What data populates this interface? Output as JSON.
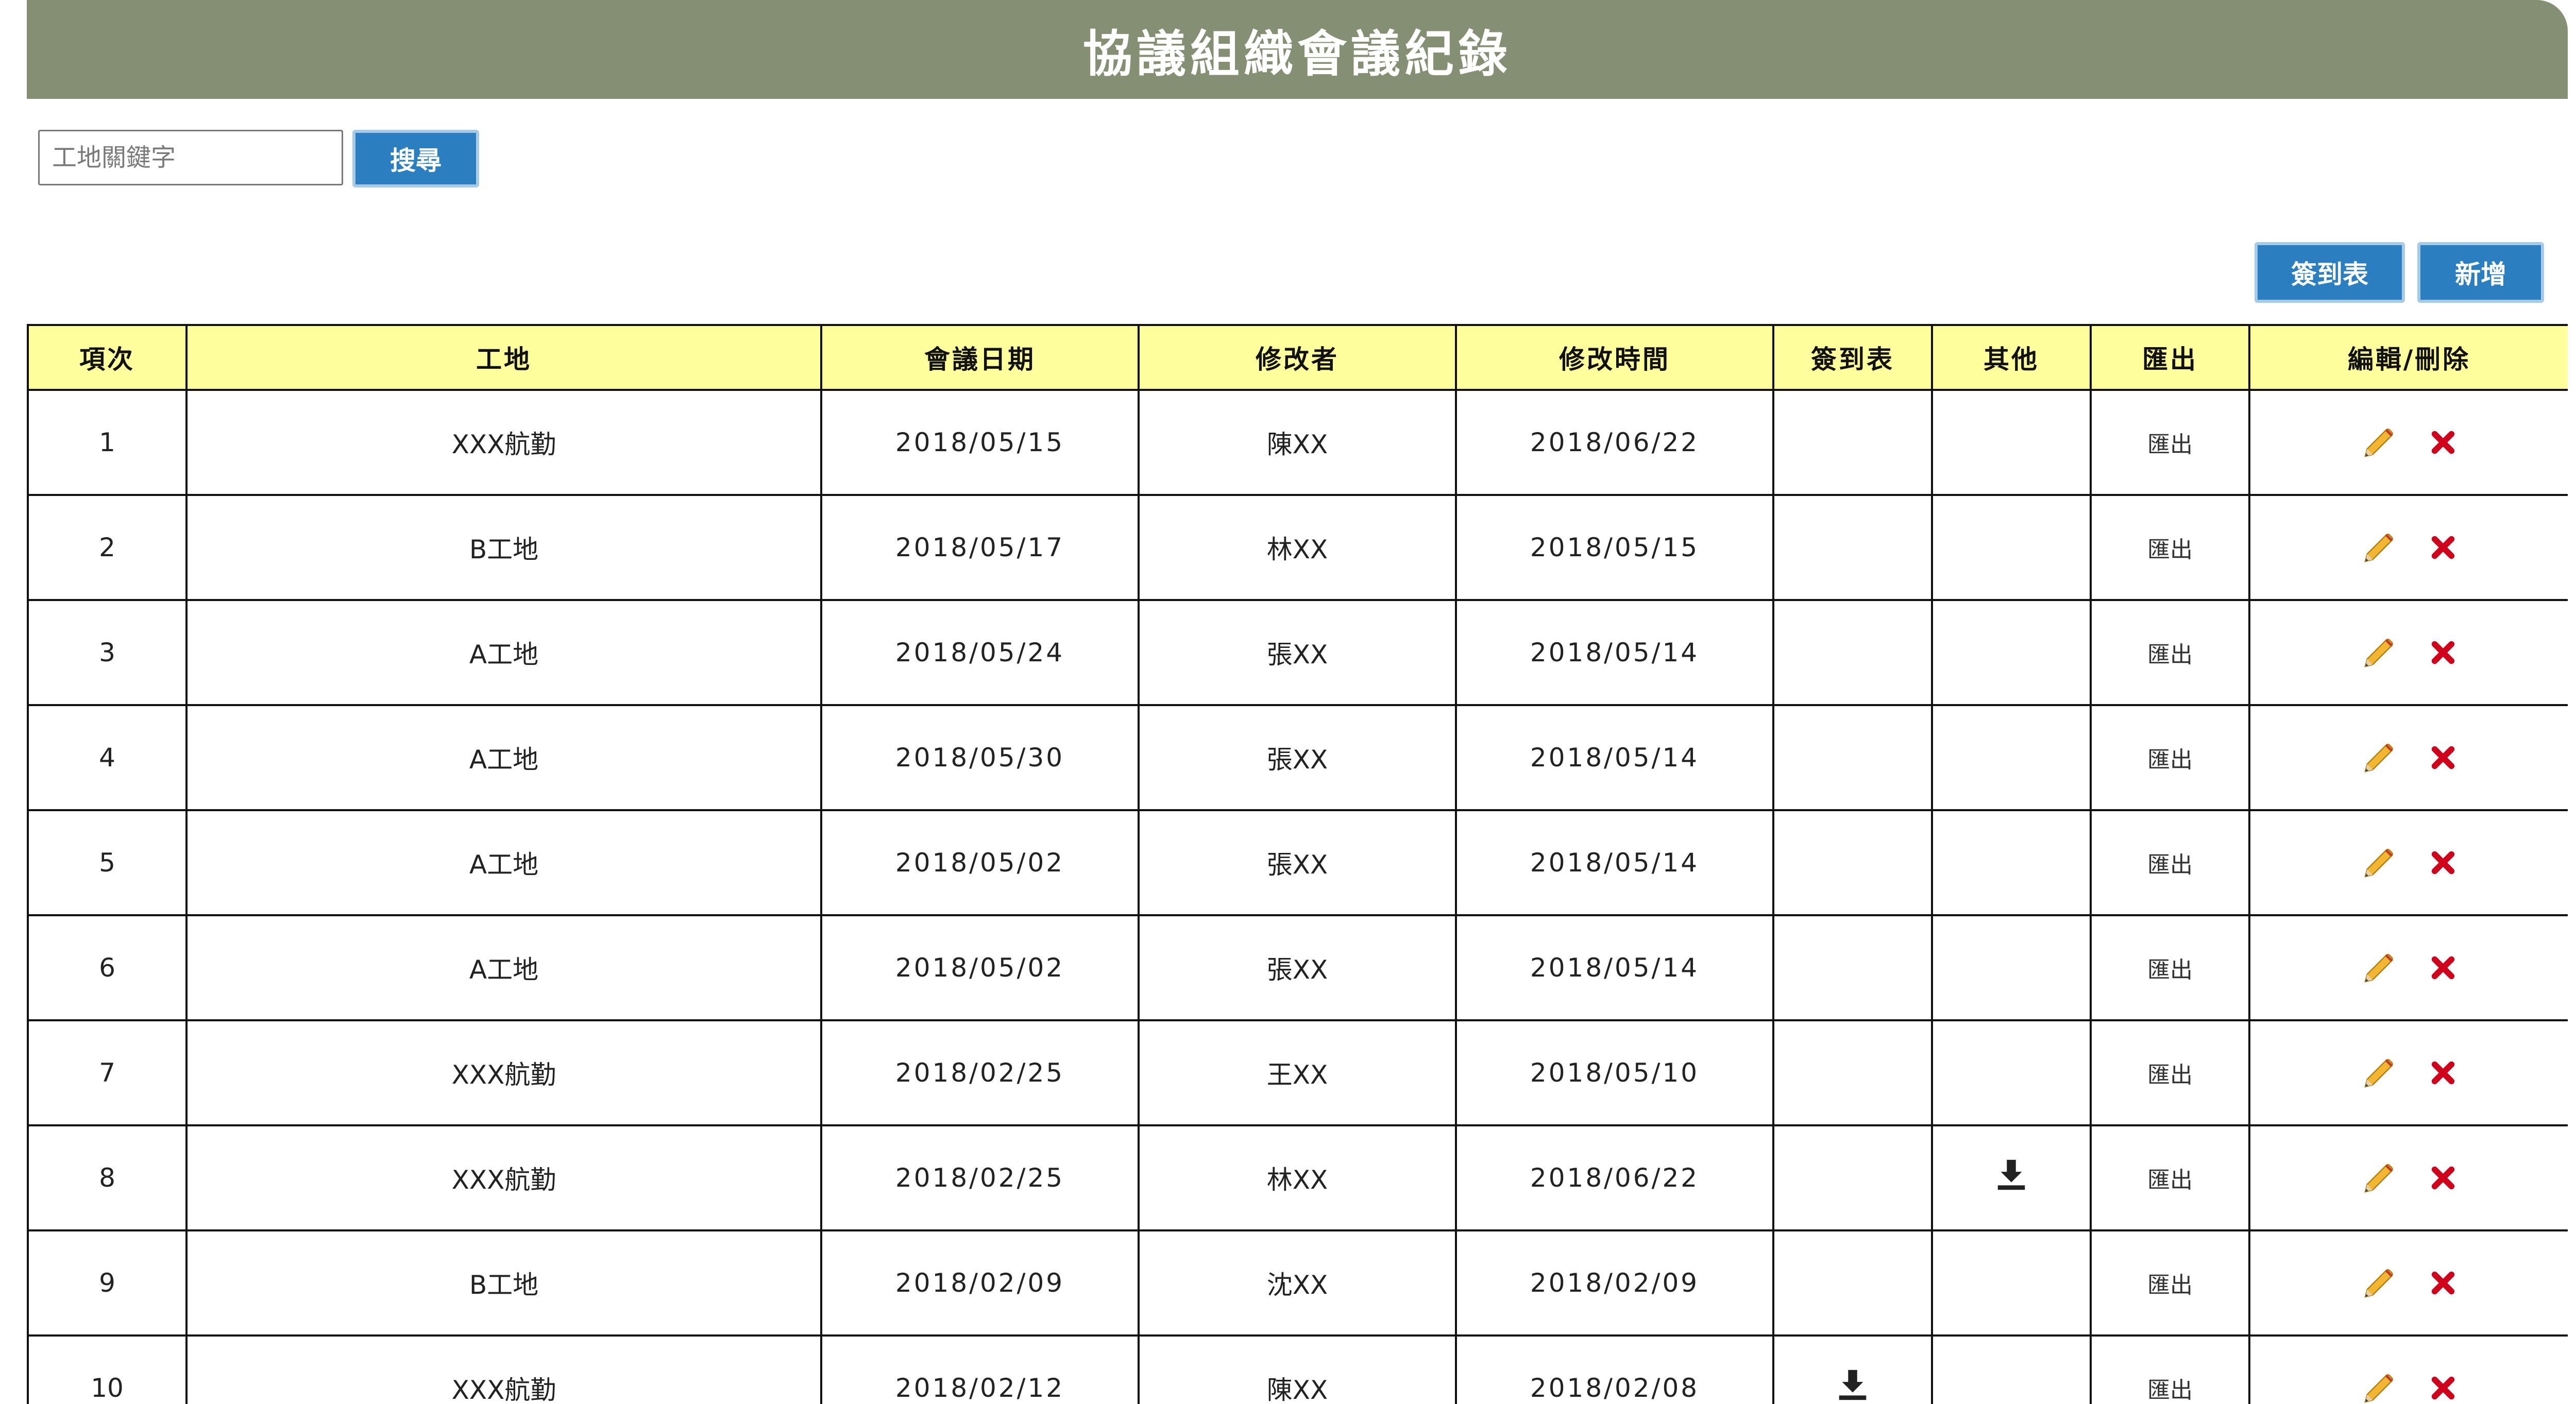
{
  "header": {
    "title": "協議組織會議紀錄"
  },
  "search": {
    "placeholder": "工地關鍵字",
    "button_label": "搜尋"
  },
  "actions": {
    "signin_label": "簽到表",
    "add_label": "新增"
  },
  "table": {
    "columns": [
      "項次",
      "工地",
      "會議日期",
      "修改者",
      "修改時間",
      "簽到表",
      "其他",
      "匯出",
      "編輯/刪除"
    ],
    "export_label": "匯出",
    "rows": [
      {
        "no": "1",
        "site": "XXX航勤",
        "date": "2018/05/15",
        "editor": "陳XX",
        "modified": "2018/06/22",
        "signin_download": false,
        "other_download": false
      },
      {
        "no": "2",
        "site": "B工地",
        "date": "2018/05/17",
        "editor": "林XX",
        "modified": "2018/05/15",
        "signin_download": false,
        "other_download": false
      },
      {
        "no": "3",
        "site": "A工地",
        "date": "2018/05/24",
        "editor": "張XX",
        "modified": "2018/05/14",
        "signin_download": false,
        "other_download": false
      },
      {
        "no": "4",
        "site": "A工地",
        "date": "2018/05/30",
        "editor": "張XX",
        "modified": "2018/05/14",
        "signin_download": false,
        "other_download": false
      },
      {
        "no": "5",
        "site": "A工地",
        "date": "2018/05/02",
        "editor": "張XX",
        "modified": "2018/05/14",
        "signin_download": false,
        "other_download": false
      },
      {
        "no": "6",
        "site": "A工地",
        "date": "2018/05/02",
        "editor": "張XX",
        "modified": "2018/05/14",
        "signin_download": false,
        "other_download": false
      },
      {
        "no": "7",
        "site": "XXX航勤",
        "date": "2018/02/25",
        "editor": "王XX",
        "modified": "2018/05/10",
        "signin_download": false,
        "other_download": false
      },
      {
        "no": "8",
        "site": "XXX航勤",
        "date": "2018/02/25",
        "editor": "林XX",
        "modified": "2018/06/22",
        "signin_download": false,
        "other_download": true
      },
      {
        "no": "9",
        "site": "B工地",
        "date": "2018/02/09",
        "editor": "沈XX",
        "modified": "2018/02/09",
        "signin_download": false,
        "other_download": false
      },
      {
        "no": "10",
        "site": "XXX航勤",
        "date": "2018/02/12",
        "editor": "陳XX",
        "modified": "2018/02/08",
        "signin_download": true,
        "other_download": false
      }
    ]
  },
  "icons": {
    "edit": "pencil-icon",
    "delete": "delete-x-icon",
    "download": "download-icon"
  },
  "colors": {
    "title_bar": "#848f73",
    "header_row": "#fefe9c",
    "button": "#2b7fc1",
    "delete": "#d0021b"
  }
}
